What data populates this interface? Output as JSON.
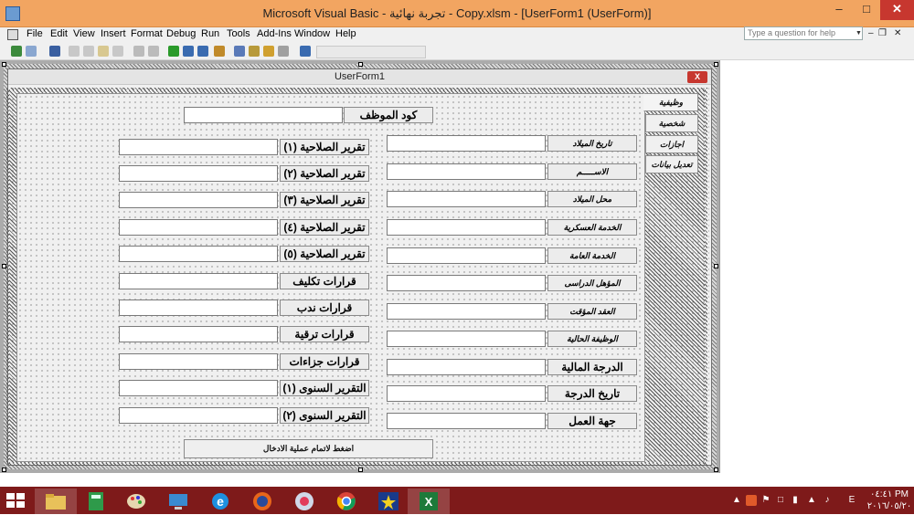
{
  "window": {
    "title": "Microsoft Visual Basic - تجربة نهائية - Copy.xlsm - [UserForm1 (UserForm)]"
  },
  "menu": [
    "File",
    "Edit",
    "View",
    "Insert",
    "Format",
    "Debug",
    "Run",
    "Tools",
    "Add-Ins",
    "Window",
    "Help"
  ],
  "help_box": {
    "placeholder": "Type a question for help"
  },
  "userform": {
    "title": "UserForm1",
    "close": "X"
  },
  "tabs": [
    "وظيفية",
    "شخصية",
    "اجازات",
    "تعديل بيانات"
  ],
  "employee_code": {
    "label": "كود الموظف",
    "value": ""
  },
  "left_fields": [
    {
      "label": "تقرير الصلاحية (١)",
      "value": ""
    },
    {
      "label": "تقرير الصلاحية (٢)",
      "value": ""
    },
    {
      "label": "تقرير الصلاحية (٣)",
      "value": ""
    },
    {
      "label": "تقرير الصلاحية (٤)",
      "value": ""
    },
    {
      "label": "تقرير الصلاحية (٥)",
      "value": ""
    },
    {
      "label": "قرارات تكليف",
      "value": ""
    },
    {
      "label": "قرارات ندب",
      "value": ""
    },
    {
      "label": "قرارات ترقية",
      "value": ""
    },
    {
      "label": "قرارات جزاءات",
      "value": ""
    },
    {
      "label": "التقرير السنوى (١)",
      "value": ""
    },
    {
      "label": "التقرير السنوى (٢)",
      "value": ""
    }
  ],
  "right_fields": [
    {
      "label": "تاريخ الميلاد",
      "style": "small",
      "value": ""
    },
    {
      "label": "الاســـــم",
      "style": "small",
      "value": ""
    },
    {
      "label": "محل الميلاد",
      "style": "small",
      "value": ""
    },
    {
      "label": "الخدمة العسكرية",
      "style": "small",
      "value": ""
    },
    {
      "label": "الخدمة العامة",
      "style": "small",
      "value": ""
    },
    {
      "label": "المؤهل الدراسى",
      "style": "small",
      "value": ""
    },
    {
      "label": "العقد المؤقت",
      "style": "small",
      "value": ""
    },
    {
      "label": "الوظيفة الحالية",
      "style": "small",
      "value": ""
    },
    {
      "label": "الدرجة المالية",
      "style": "big",
      "value": ""
    },
    {
      "label": "تاريخ الدرجة",
      "style": "big",
      "value": ""
    },
    {
      "label": "جهة العمل",
      "style": "big",
      "value": ""
    }
  ],
  "submit_button": {
    "label": "اضغط لاتمام عملية الادخال"
  },
  "taskbar": {
    "time": "٠٤:٤١ PM",
    "date": "٢٠١٦/٠٥/٢٠",
    "lang": "E"
  },
  "colors": {
    "titlebar": "#f2a561",
    "close": "#c7372f",
    "taskbar": "#7e1a1a"
  }
}
